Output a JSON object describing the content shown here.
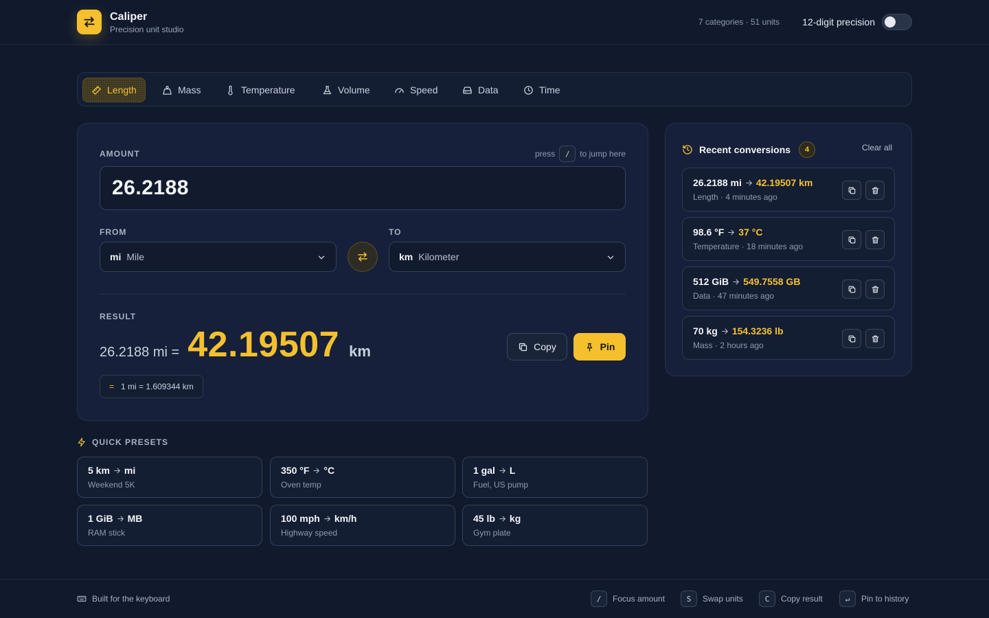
{
  "app": {
    "name": "Caliper",
    "subtitle": "Precision unit studio",
    "stats": "7 categories · 51 units",
    "precision_label": "12-digit precision",
    "precision_enabled": false,
    "accent_color": "#f5c02e"
  },
  "tabs": [
    {
      "label": "Length",
      "icon": "ruler-icon",
      "active": true
    },
    {
      "label": "Mass",
      "icon": "weight-icon",
      "active": false
    },
    {
      "label": "Temperature",
      "icon": "thermometer-icon",
      "active": false
    },
    {
      "label": "Volume",
      "icon": "flask-icon",
      "active": false
    },
    {
      "label": "Speed",
      "icon": "gauge-icon",
      "active": false
    },
    {
      "label": "Data",
      "icon": "drive-icon",
      "active": false
    },
    {
      "label": "Time",
      "icon": "clock-icon",
      "active": false
    }
  ],
  "converter": {
    "amount_label": "AMOUNT",
    "hint_prefix": "press",
    "hint_key": "/",
    "hint_suffix": "to jump here",
    "amount_value": "26.2188",
    "from_label": "FROM",
    "to_label": "TO",
    "from": {
      "symbol": "mi",
      "name": "Mile"
    },
    "to": {
      "symbol": "km",
      "name": "Kilometer"
    },
    "result_label": "RESULT",
    "result_from": "26.2188 mi =",
    "result_value": "42.19507",
    "result_unit": "km",
    "copy_label": "Copy",
    "pin_label": "Pin",
    "rate_symbol": "=",
    "rate": "1 mi = 1.609344 km"
  },
  "presets": {
    "title": "QUICK PRESETS",
    "items": [
      {
        "from": "5 km",
        "to": "mi",
        "caption": "Weekend 5K"
      },
      {
        "from": "350 °F",
        "to": "°C",
        "caption": "Oven temp"
      },
      {
        "from": "1 gal",
        "to": "L",
        "caption": "Fuel, US pump"
      },
      {
        "from": "1 GiB",
        "to": "MB",
        "caption": "RAM stick"
      },
      {
        "from": "100 mph",
        "to": "km/h",
        "caption": "Highway speed"
      },
      {
        "from": "45 lb",
        "to": "kg",
        "caption": "Gym plate"
      }
    ]
  },
  "recent": {
    "title": "Recent conversions",
    "count": "4",
    "clear_label": "Clear all",
    "items": [
      {
        "from": "26.2188 mi",
        "to": "42.19507 km",
        "meta": "Length · 4 minutes ago"
      },
      {
        "from": "98.6 °F",
        "to": "37 °C",
        "meta": "Temperature · 18 minutes ago"
      },
      {
        "from": "512 GiB",
        "to": "549.7558 GB",
        "meta": "Data · 47 minutes ago"
      },
      {
        "from": "70 kg",
        "to": "154.3236 lb",
        "meta": "Mass · 2 hours ago"
      }
    ]
  },
  "footer": {
    "tagline": "Built for the keyboard",
    "shortcuts": [
      {
        "key": "/",
        "label": "Focus amount"
      },
      {
        "key": "S",
        "label": "Swap units"
      },
      {
        "key": "C",
        "label": "Copy result"
      },
      {
        "key": "↵",
        "label": "Pin to history"
      }
    ]
  }
}
